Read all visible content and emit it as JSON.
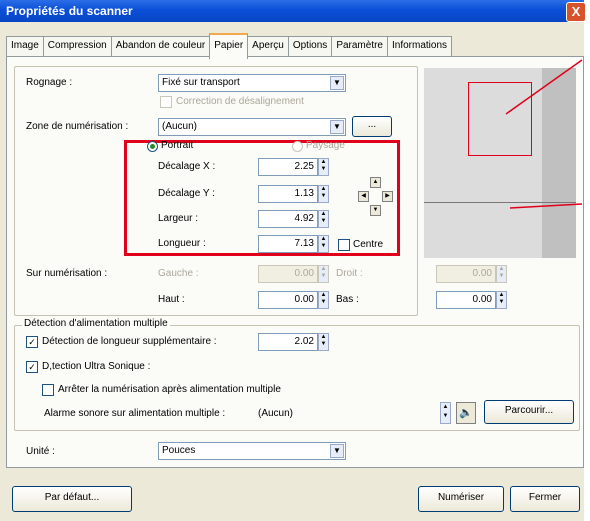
{
  "window": {
    "title": "Propriétés du scanner",
    "close_glyph": "X"
  },
  "tabs": [
    "Image",
    "Compression",
    "Abandon de couleur",
    "Papier",
    "Aperçu",
    "Options",
    "Paramètre",
    "Informations"
  ],
  "active_tab": "Papier",
  "rognage": {
    "label": "Rognage :",
    "value": "Fixé sur transport"
  },
  "correction": {
    "label": "Correction de désalignement"
  },
  "zone": {
    "label": "Zone de numérisation :",
    "value": "(Aucun)",
    "browse": "..."
  },
  "orientation": {
    "portrait": "Portrait",
    "paysage": "Paysage"
  },
  "fields": {
    "decalage_x": {
      "label": "Décalage X :",
      "value": "2.25"
    },
    "decalage_y": {
      "label": "Décalage Y :",
      "value": "1.13"
    },
    "largeur": {
      "label": "Largeur :",
      "value": "4.92"
    },
    "longueur": {
      "label": "Longueur :",
      "value": "7.13"
    }
  },
  "centre": {
    "label": "Centre"
  },
  "overscan": {
    "label": "Sur numérisation :",
    "gauche": {
      "label": "Gauche :",
      "value": "0.00"
    },
    "droit": {
      "label": "Droit :",
      "value": "0.00"
    },
    "haut": {
      "label": "Haut :",
      "value": "0.00"
    },
    "bas": {
      "label": "Bas :",
      "value": "0.00"
    }
  },
  "multifeed": {
    "group_label": "Détection d'alimentation multiple",
    "length_label": "Détection de longueur supplémentaire :",
    "length_value": "2.02",
    "ultrasonic_label": "D,tection Ultra Sonique :",
    "stop_label": "Arrêter la numérisation après alimentation multiple",
    "alarm_label": "Alarme sonore sur alimentation multiple :",
    "alarm_value": "(Aucun)",
    "browse_label": "Parcourir..."
  },
  "unite": {
    "label": "Unité :",
    "value": "Pouces"
  },
  "buttons": {
    "default": "Par défaut...",
    "scan": "Numériser",
    "close": "Fermer"
  },
  "colors": {
    "highlight": "#e0001b",
    "titlebar": "#0a4fd8"
  }
}
